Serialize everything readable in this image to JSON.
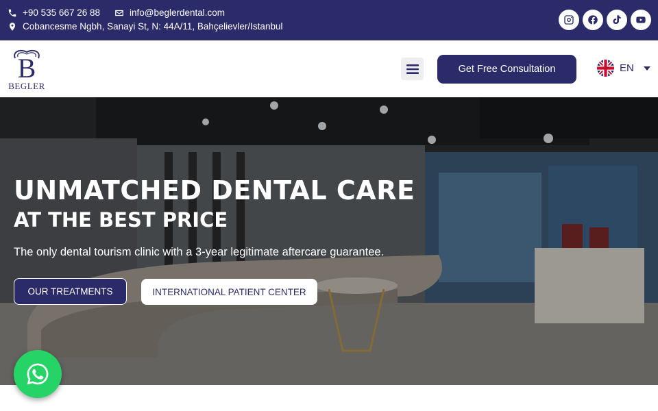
{
  "topbar": {
    "phone": "+90 535 667 26 88",
    "email": "info@beglerdental.com",
    "address": "Cobancesme Ngbh, Sanayi St, N: 44A/11, Bahçelievler/Istanbul",
    "socials": [
      "instagram-icon",
      "facebook-icon",
      "tiktok-icon",
      "youtube-icon"
    ]
  },
  "header": {
    "logo_text": "BEGLER",
    "cta_label": "Get Free Consultation",
    "language": "EN"
  },
  "hero": {
    "title_line1": "UNMATCHED DENTAL CARE",
    "title_line2": "AT THE BEST PRICE",
    "subtitle": "The only dental tourism clinic with a 3-year legitimate aftercare guarantee.",
    "primary_button": "OUR TREATMENTS",
    "secondary_button": "INTERNATIONAL PATIENT CENTER"
  },
  "colors": {
    "brand": "#2c2b69",
    "whatsapp": "#25d366"
  }
}
